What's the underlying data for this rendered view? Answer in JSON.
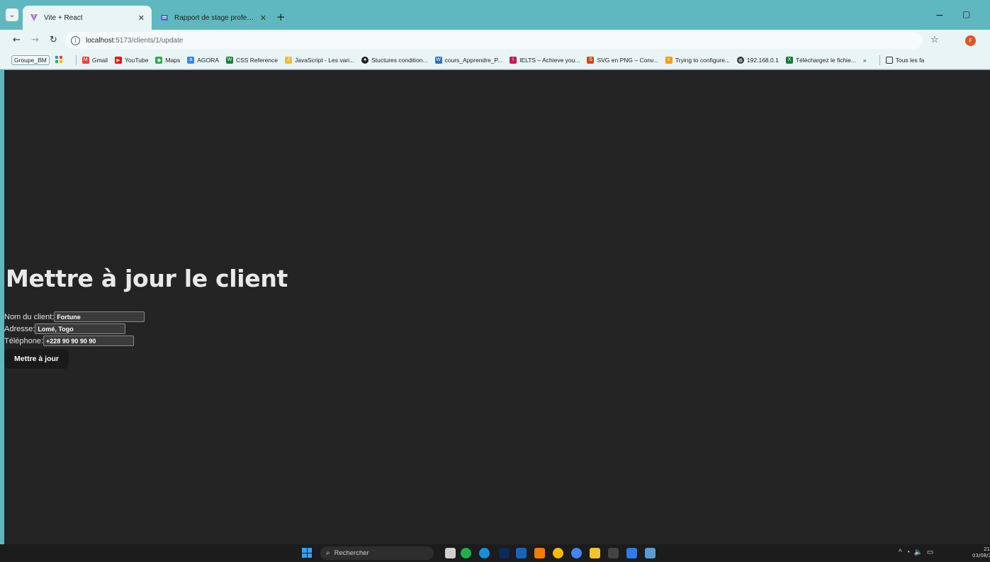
{
  "browser": {
    "tabs": [
      {
        "label": "Vite + React",
        "active": true
      },
      {
        "label": "Rapport de stage professionnel",
        "active": false
      }
    ],
    "new_tab": "+",
    "url_host": "localhost",
    "url_path": ":5173/clients/1/update",
    "profile_initial": "F"
  },
  "bookmarks": [
    "Groupe_BM",
    "Gmail",
    "YouTube",
    "Maps",
    "AGORA",
    "CSS Reference",
    "JavaScript - Les vari...",
    "Stuctures condition...",
    "cours_Apprendre_P...",
    "IELTS – Achieve you...",
    "SVG en PNG – Conv...",
    "Trying to configure...",
    "192.168.0.1",
    "Téléchargez le fichie...",
    "»",
    "Tous les fa"
  ],
  "page": {
    "title": "Mettre à jour le client",
    "fields": [
      {
        "label": "Nom du client:",
        "value": "Fortune"
      },
      {
        "label": "Adresse:",
        "value": "Lomé, Togo"
      },
      {
        "label": "Téléphone:",
        "value": "+228 90 90 90 90"
      }
    ],
    "submit_label": "Mettre à jour"
  },
  "taskbar": {
    "search_placeholder": "Rechercher",
    "clock_time": "21",
    "clock_date": "03/08/2"
  },
  "colors": {
    "browser_chrome": "#5fb8c0",
    "page_background": "#242424",
    "button_background": "#1a1a1a"
  }
}
